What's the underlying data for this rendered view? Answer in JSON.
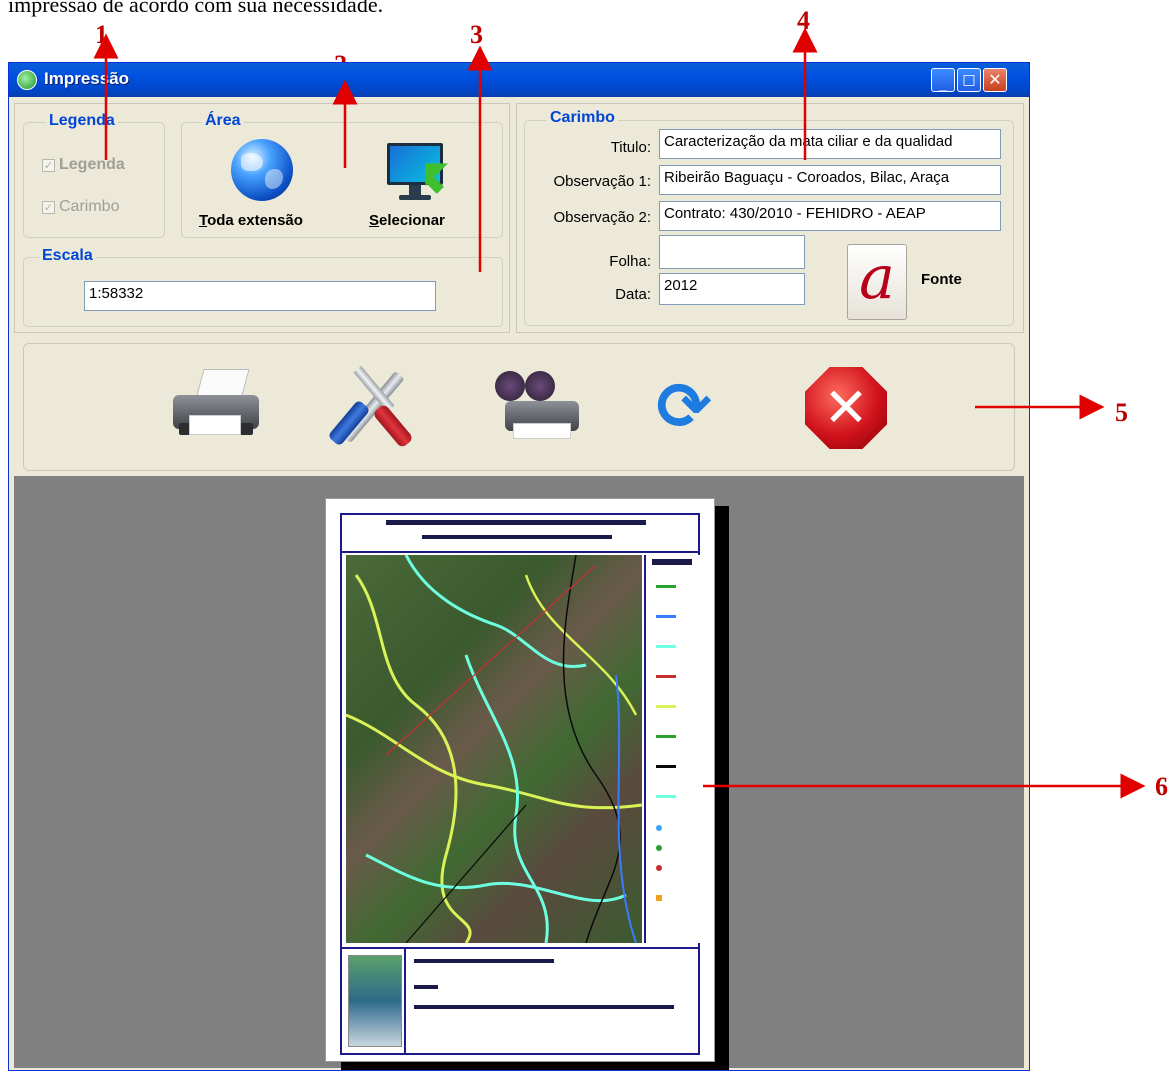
{
  "caption": "impressão de acordo com sua necessidade.",
  "annotations": [
    "1",
    "2",
    "3",
    "4",
    "5",
    "6"
  ],
  "window": {
    "title": "Impressão",
    "controls": {
      "minimize": "minimize-icon",
      "maximize": "maximize-icon",
      "close": "close-icon"
    }
  },
  "legenda": {
    "group_title": "Legenda",
    "legenda_label": "Legenda",
    "carimbo_label": "Carimbo"
  },
  "area": {
    "group_title": "Área",
    "toda_first": "T",
    "toda_rest": "oda extensão",
    "sel_first": "S",
    "sel_rest": "elecionar"
  },
  "escala": {
    "group_title": "Escala",
    "value": "1:58332"
  },
  "carimbo": {
    "group_title": "Carimbo",
    "titulo_label": "Titulo:",
    "titulo_value": "Caracterização da mata ciliar e da qualidad",
    "obs1_label": "Observação 1:",
    "obs1_value": "Ribeirão Baguaçu - Coroados, Bilac, Araça",
    "obs2_label": "Observação 2:",
    "obs2_value": "Contrato: 430/2010 -  FEHIDRO - AEAP",
    "folha_label": "Folha:",
    "folha_value": "",
    "data_label": "Data:",
    "data_value": "2012",
    "fonte_label": "Fonte"
  },
  "colors": {
    "accent": "#0046d5",
    "annotation": "#c00000",
    "titlebar": "#0050e0",
    "preview_bg": "#808080",
    "window_bg": "#ece9d8"
  },
  "toolbar_icons": [
    "printer-icon",
    "tools-icon",
    "print-preview-icon",
    "refresh-icon",
    "cancel-icon"
  ]
}
